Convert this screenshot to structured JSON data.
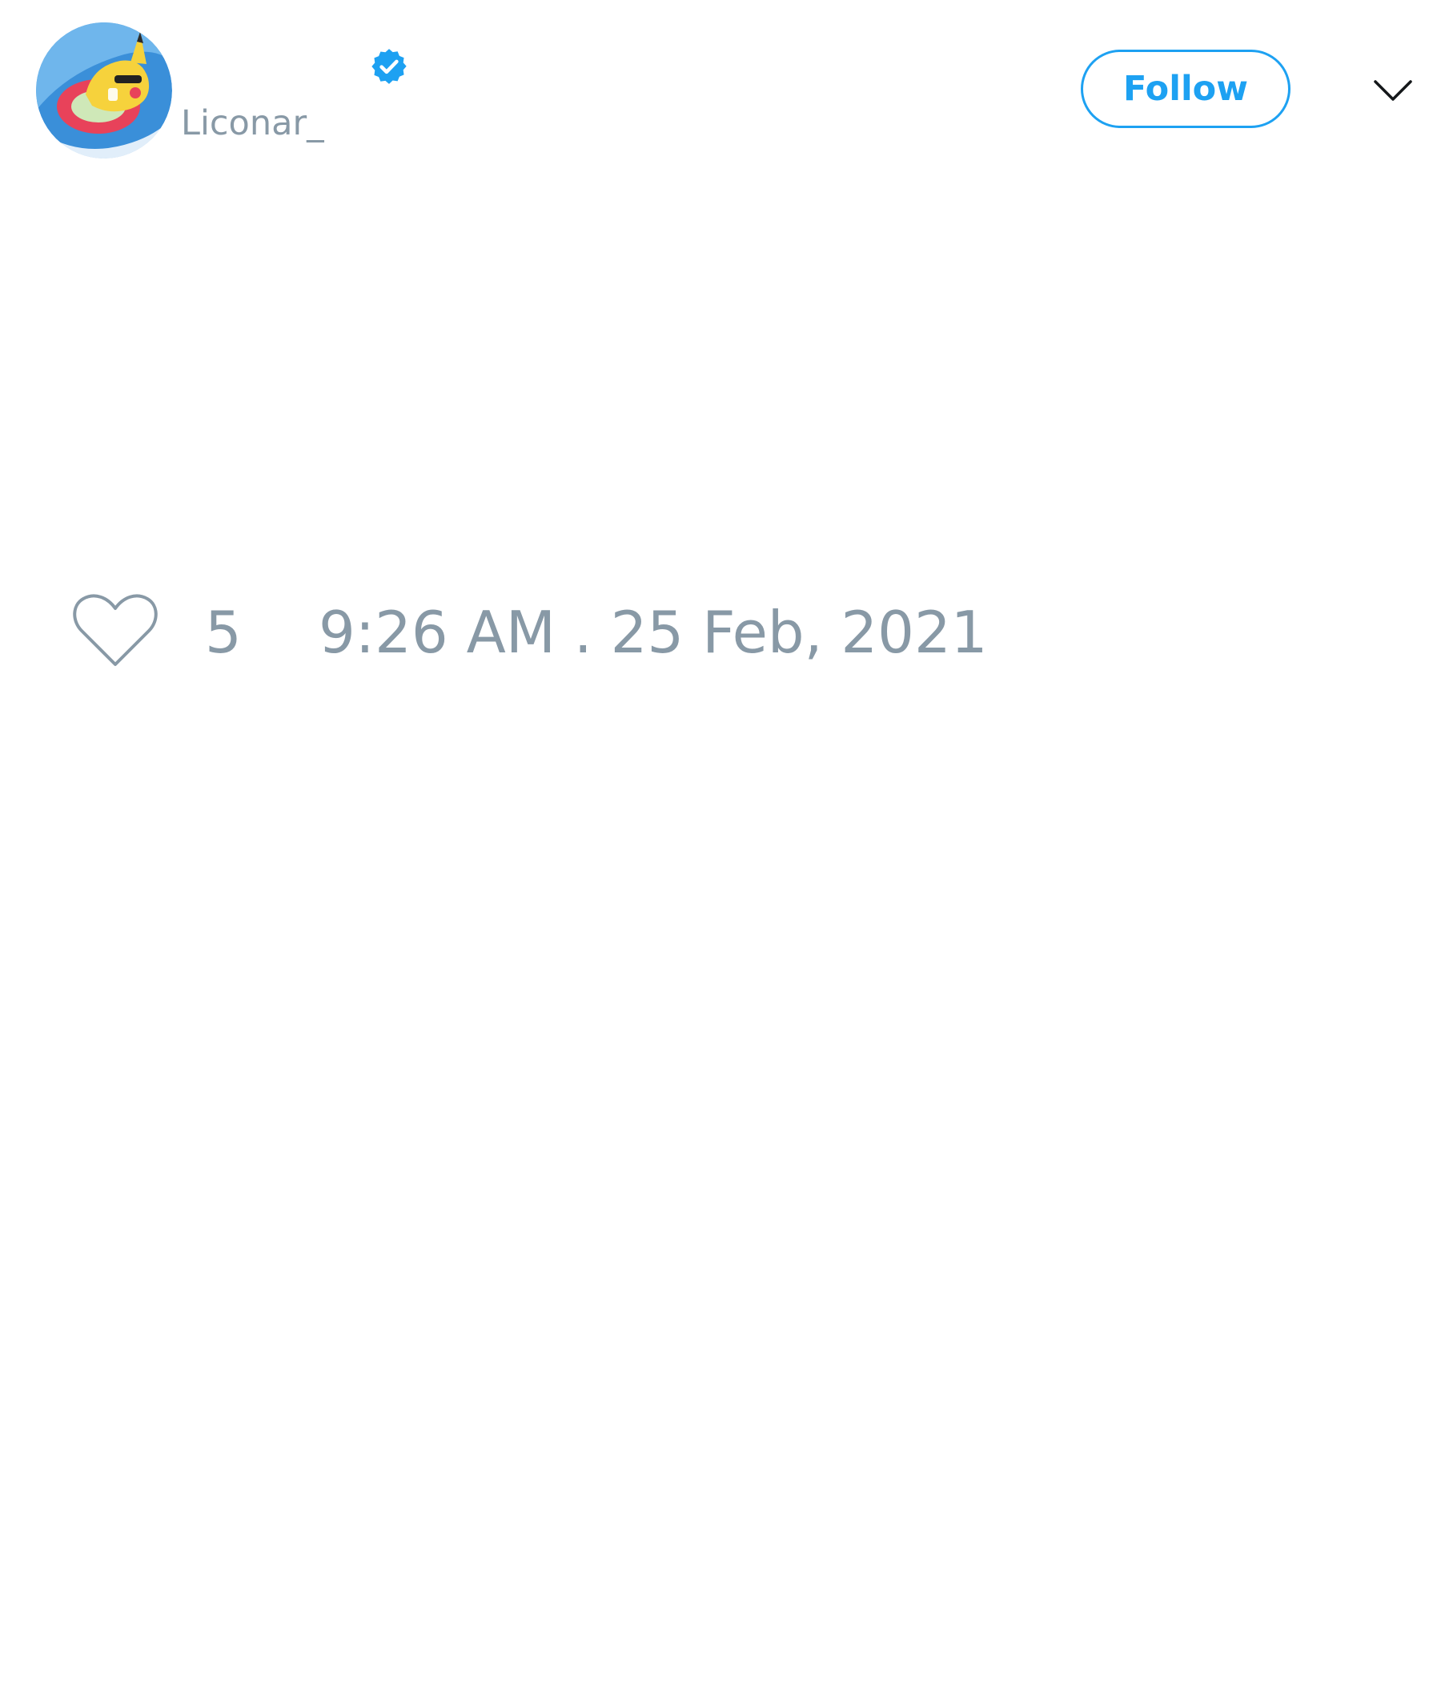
{
  "tweet": {
    "author": {
      "handle": "Liconar_",
      "verified": true,
      "avatar_icon": "pikachu-avatar-icon"
    },
    "follow_label": "Follow",
    "menu_icon": "chevron-down-icon",
    "like_icon": "heart-icon",
    "like_count": "5",
    "timestamp": "9:26 AM . 25 Feb, 2021"
  },
  "colors": {
    "accent": "#1da1f2",
    "muted_text": "#8899a6",
    "background": "#ffffff"
  }
}
